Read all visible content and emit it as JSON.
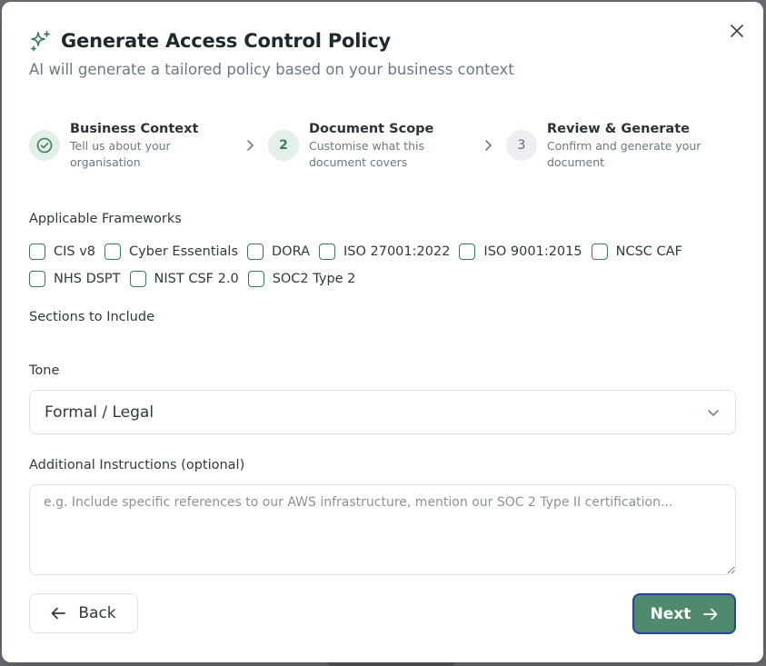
{
  "header": {
    "title": "Generate Access Control Policy",
    "subtitle": "AI will generate a tailored policy based on your business context"
  },
  "stepper": {
    "steps": [
      {
        "number": "1",
        "title": "Business Context",
        "desc_line1": "Tell us about your",
        "desc_line2": "organisation",
        "state": "complete"
      },
      {
        "number": "2",
        "title": "Document Scope",
        "desc_line1": "Customise what this",
        "desc_line2": "document covers",
        "state": "active"
      },
      {
        "number": "3",
        "title": "Review & Generate",
        "desc_line1": "Confirm and generate your",
        "desc_line2": "document",
        "state": "upcoming"
      }
    ]
  },
  "frameworks": {
    "label": "Applicable Frameworks",
    "items": [
      "CIS v8",
      "Cyber Essentials",
      "DORA",
      "ISO 27001:2022",
      "ISO 9001:2015",
      "NCSC CAF",
      "NHS DSPT",
      "NIST CSF 2.0",
      "SOC2 Type 2"
    ]
  },
  "sections": {
    "label": "Sections to Include"
  },
  "tone": {
    "label": "Tone",
    "selected": "Formal / Legal"
  },
  "instructions": {
    "label": "Additional Instructions (optional)",
    "value": "",
    "placeholder": "e.g. Include specific references to our AWS infrastructure, mention our SOC 2 Type II certification..."
  },
  "footer": {
    "back_label": "Back",
    "next_label": "Next"
  },
  "colors": {
    "brand_green": "#4e8a6b",
    "focus_ring": "#2b3fa8",
    "step_bg_active": "#e3f0e8",
    "step_bg_future": "#eceef1"
  },
  "icons": {
    "title": "sparkles-icon",
    "close": "close-icon",
    "step_complete": "check-circle-icon",
    "step_separator": "chevron-right-icon",
    "select": "chevron-down-icon",
    "back": "arrow-left-icon",
    "next": "arrow-right-icon"
  }
}
